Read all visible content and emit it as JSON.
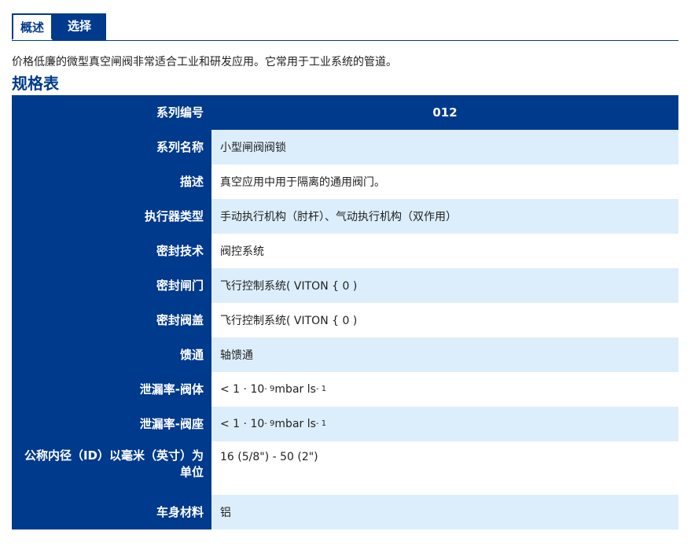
{
  "tabs": [
    {
      "label": "概述",
      "active": true
    },
    {
      "label": "选择",
      "active": false
    }
  ],
  "intro": "价格低廉的微型真空闸阀非常适合工业和研发应用。它常用于工业系统的管道。",
  "heading": "规格表",
  "spec": {
    "series_no": {
      "key": "系列编号",
      "value": "012"
    },
    "series_name": {
      "key": "系列名称",
      "value": "小型闸阀阀锁"
    },
    "description": {
      "key": "描述",
      "value": "真空应用中用于隔离的通用阀门。"
    },
    "actuator": {
      "key": "执行器类型",
      "value": "手动执行机构（肘杆）、气动执行机构（双作用）"
    },
    "seal_tech": {
      "key": "密封技术",
      "value": "阀控系统"
    },
    "seal_gate": {
      "key": "密封闸门",
      "value": "飞行控制系统( VITON { 0 )"
    },
    "seal_bonnet": {
      "key": "密封阀盖",
      "value": "飞行控制系统( VITON { 0 )"
    },
    "feedthrough": {
      "key": "馈通",
      "value": "轴馈通"
    },
    "leak_body": {
      "key": "泄漏率-阀体",
      "pre": "< 1 · 10",
      "exp1": "- 9",
      "mid": " mbar ls",
      "exp2": "- 1"
    },
    "leak_seat": {
      "key": "泄漏率-阀座",
      "pre": "< 1 · 10",
      "exp1": "- 9",
      "mid": " mbar ls",
      "exp2": "- 1"
    },
    "nominal_id": {
      "key": "公称内径（ID）以毫米（英寸）为单位",
      "value": "16 (5/8\") - 50 (2\")"
    },
    "body_material": {
      "key": "车身材料",
      "value": "铝"
    }
  },
  "colors": {
    "brand": "#003a8c",
    "row_alt": "#dceefc"
  }
}
